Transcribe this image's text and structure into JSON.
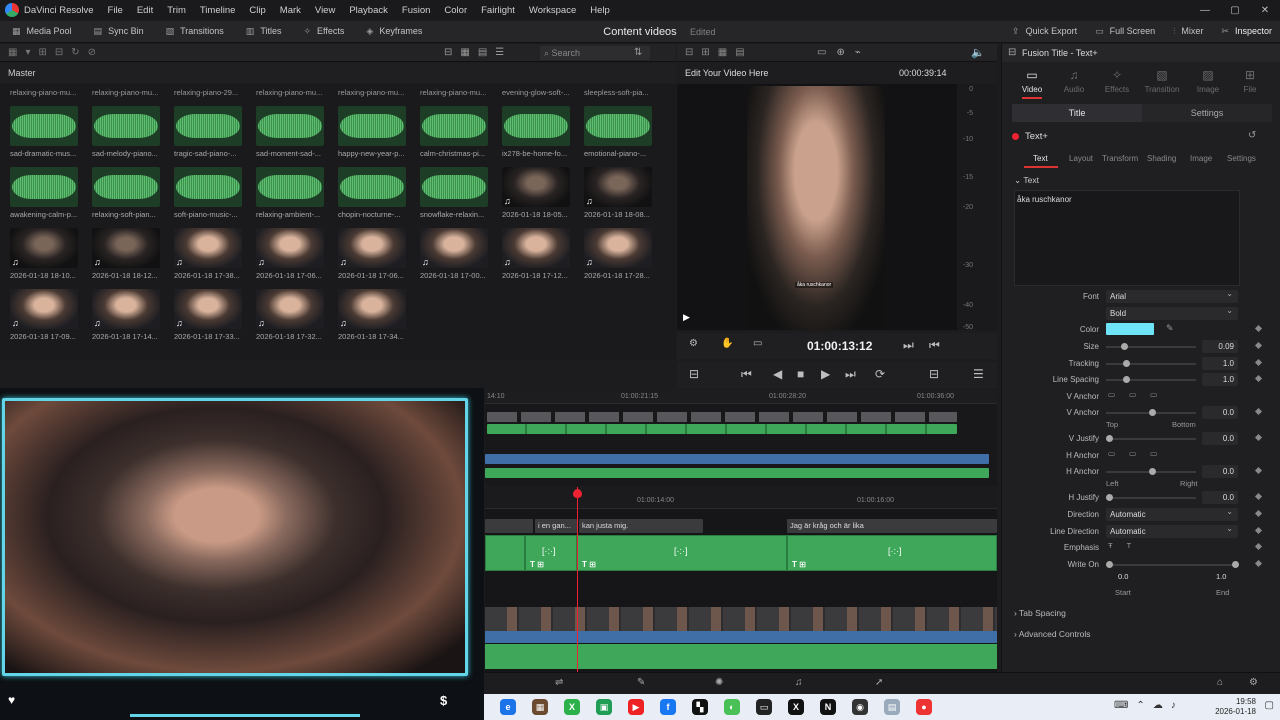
{
  "app": {
    "name": "DaVinci Resolve"
  },
  "menu": [
    "File",
    "Edit",
    "Trim",
    "Timeline",
    "Clip",
    "Mark",
    "View",
    "Playback",
    "Fusion",
    "Color",
    "Fairlight",
    "Workspace",
    "Help"
  ],
  "toolbar": {
    "items": [
      "Media Pool",
      "Sync Bin",
      "Transitions",
      "Titles",
      "Effects",
      "Keyframes"
    ],
    "project_title": "Content videos",
    "project_status": "Edited",
    "right_items": [
      "Quick Export",
      "Full Screen",
      "Mixer",
      "Inspector"
    ]
  },
  "media_pool": {
    "search_placeholder": "Search",
    "bin": "Master",
    "top_labels": [
      "relaxing-piano-mu...",
      "relaxing-piano-mu...",
      "relaxing-piano-29...",
      "relaxing-piano-mu...",
      "relaxing-piano-mu...",
      "relaxing-piano-mu...",
      "evening-glow-soft-...",
      "sleepless-soft-pia..."
    ],
    "clips": [
      {
        "label": "sad-dramatic-mus...",
        "kind": "audio"
      },
      {
        "label": "sad-melody-piano...",
        "kind": "audio"
      },
      {
        "label": "tragic-sad-piano-...",
        "kind": "audio"
      },
      {
        "label": "sad-moment-sad-...",
        "kind": "audio"
      },
      {
        "label": "happy-new-year-p...",
        "kind": "audio"
      },
      {
        "label": "calm-christmas-pi...",
        "kind": "audio"
      },
      {
        "label": "ix278-be-home-fo...",
        "kind": "audio"
      },
      {
        "label": "emotional-piano-...",
        "kind": "audio"
      },
      {
        "label": "awakening-calm-p...",
        "kind": "audio"
      },
      {
        "label": "relaxing-soft-pian...",
        "kind": "audio"
      },
      {
        "label": "soft-piano-music-...",
        "kind": "audio"
      },
      {
        "label": "relaxing-ambient-...",
        "kind": "audio"
      },
      {
        "label": "chopin-nocturne-...",
        "kind": "audio"
      },
      {
        "label": "snowflake-relaxin...",
        "kind": "audio"
      },
      {
        "label": "2026-01-18 18-05...",
        "kind": "video-dark"
      },
      {
        "label": "2026-01-18 18-08...",
        "kind": "video-dark"
      },
      {
        "label": "2026-01-18 18-10...",
        "kind": "video-dark"
      },
      {
        "label": "2026-01-18 18-12...",
        "kind": "video-dark"
      },
      {
        "label": "2026-01-18 17-38...",
        "kind": "video"
      },
      {
        "label": "2026-01-18 17-06...",
        "kind": "video"
      },
      {
        "label": "2026-01-18 17-06...",
        "kind": "video"
      },
      {
        "label": "2026-01-18 17-00...",
        "kind": "video"
      },
      {
        "label": "2026-01-18 17-12...",
        "kind": "video"
      },
      {
        "label": "2026-01-18 17-28...",
        "kind": "video"
      },
      {
        "label": "2026-01-18 17-09...",
        "kind": "video"
      },
      {
        "label": "2026-01-18 17-14...",
        "kind": "video"
      },
      {
        "label": "2026-01-18 17-33...",
        "kind": "video"
      },
      {
        "label": "2026-01-18 17-32...",
        "kind": "video"
      },
      {
        "label": "2026-01-18 17-34...",
        "kind": "video"
      }
    ]
  },
  "viewer": {
    "name": "Edit Your Video Here",
    "duration": "00:00:39:14",
    "timecode": "01:00:13:12",
    "caption": "åka ruschkanor",
    "scale": [
      "0",
      "-5",
      "-10",
      "-15",
      "-20",
      "-30",
      "-40",
      "-50"
    ]
  },
  "inspector": {
    "title": "Fusion Title - Text+",
    "tabs": [
      "Video",
      "Audio",
      "Effects",
      "Transition",
      "Image",
      "File"
    ],
    "segments": [
      "Title",
      "Settings"
    ],
    "node": "Text+",
    "subtabs": [
      "Text",
      "Layout",
      "Transform",
      "Shading",
      "Image",
      "Settings"
    ],
    "section": "Text",
    "text_value": "åka ruschkanor",
    "font": "Arial",
    "style": "Bold",
    "labels": {
      "font": "Font",
      "color": "Color",
      "size": "Size",
      "tracking": "Tracking",
      "line_spacing": "Line Spacing",
      "v_anchor": "V Anchor",
      "v_justify": "V Justify",
      "h_anchor": "H Anchor",
      "h_justify": "H Justify",
      "direction": "Direction",
      "line_direction": "Line Direction",
      "emphasis": "Emphasis",
      "write_on": "Write On",
      "top": "Top",
      "bottom": "Bottom",
      "left": "Left",
      "right": "Right",
      "start": "Start",
      "end": "End"
    },
    "values": {
      "size": "0.09",
      "tracking": "1.0",
      "line_spacing": "1.0",
      "v_anchor": "0.0",
      "v_justify": "0.0",
      "h_anchor": "0.0",
      "h_justify": "0.0",
      "direction": "Automatic",
      "line_direction": "Automatic",
      "write_on_start": "0.0",
      "write_on_end": "1.0"
    },
    "color_hex": "#6fe3f7",
    "collapsed": [
      "Tab Spacing",
      "Advanced Controls"
    ]
  },
  "timeline": {
    "ruler_top": [
      "14:10",
      "01:00:21:15",
      "01:00:28:20",
      "01:00:36:00"
    ],
    "ruler_main": [
      "01:00:14:00",
      "01:00:16:00"
    ],
    "subtitles": [
      "i en gan...",
      "kan justa mig.",
      "Jag är kråg och är lika"
    ]
  },
  "taskbar": {
    "time": "19:58",
    "date": "2026-01-18"
  }
}
